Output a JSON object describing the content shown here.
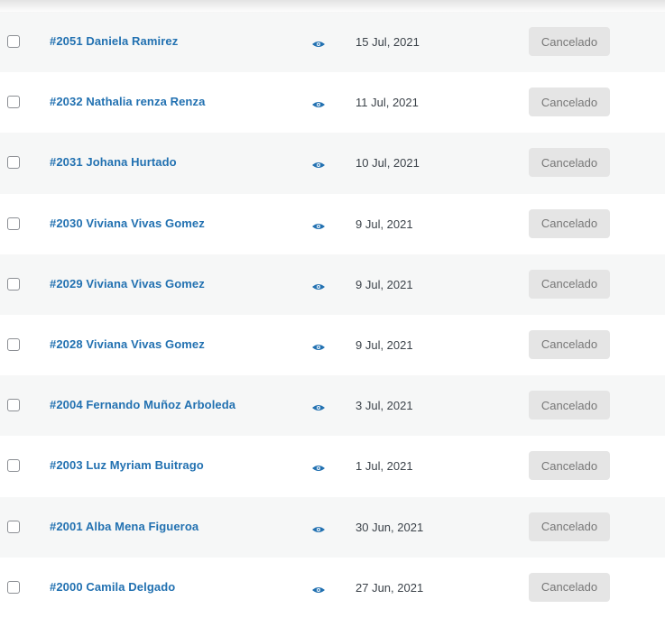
{
  "orders": [
    {
      "label": "#2051 Daniela Ramirez",
      "date": "15 Jul, 2021",
      "status": "Cancelado"
    },
    {
      "label": "#2032 Nathalia renza Renza",
      "date": "11 Jul, 2021",
      "status": "Cancelado"
    },
    {
      "label": "#2031 Johana Hurtado",
      "date": "10 Jul, 2021",
      "status": "Cancelado"
    },
    {
      "label": "#2030 Viviana Vivas Gomez",
      "date": "9 Jul, 2021",
      "status": "Cancelado"
    },
    {
      "label": "#2029 Viviana Vivas Gomez",
      "date": "9 Jul, 2021",
      "status": "Cancelado"
    },
    {
      "label": "#2028 Viviana Vivas Gomez",
      "date": "9 Jul, 2021",
      "status": "Cancelado"
    },
    {
      "label": "#2004 Fernando Muñoz Arboleda",
      "date": "3 Jul, 2021",
      "status": "Cancelado"
    },
    {
      "label": "#2003 Luz Myriam Buitrago",
      "date": "1 Jul, 2021",
      "status": "Cancelado"
    },
    {
      "label": "#2001 Alba Mena Figueroa",
      "date": "30 Jun, 2021",
      "status": "Cancelado"
    },
    {
      "label": "#2000 Camila Delgado",
      "date": "27 Jun, 2021",
      "status": "Cancelado"
    }
  ],
  "icons": {
    "preview": "eye-icon",
    "select": "checkbox"
  },
  "colors": {
    "link": "#2271b1",
    "status_bg": "#e5e5e5",
    "status_text": "#777777",
    "row_alt": "#f6f7f7"
  }
}
